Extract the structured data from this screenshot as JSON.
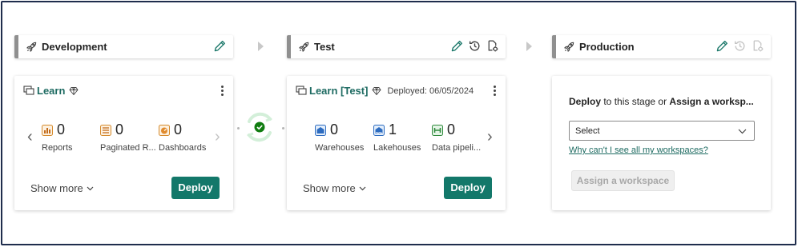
{
  "stages": [
    {
      "title": "Development",
      "workspace": "Learn",
      "deployed": "",
      "items": [
        {
          "count": "0",
          "label": "Reports",
          "icon": "report-icon"
        },
        {
          "count": "0",
          "label": "Paginated R...",
          "icon": "paginated-report-icon"
        },
        {
          "count": "0",
          "label": "Dashboards",
          "icon": "dashboard-icon"
        }
      ],
      "show_more": "Show more",
      "deploy_label": "Deploy"
    },
    {
      "title": "Test",
      "workspace": "Learn [Test]",
      "deployed": "Deployed: 06/05/2024",
      "items": [
        {
          "count": "0",
          "label": "Warehouses",
          "icon": "warehouse-icon"
        },
        {
          "count": "1",
          "label": "Lakehouses",
          "icon": "lakehouse-icon"
        },
        {
          "count": "0",
          "label": "Data pipeli...",
          "icon": "data-pipeline-icon"
        }
      ],
      "show_more": "Show more",
      "deploy_label": "Deploy"
    },
    {
      "title": "Production",
      "prompt_bold_1": "Deploy",
      "prompt_mid": " to this stage or ",
      "prompt_bold_2": "Assign a worksp...",
      "select_value": "Select",
      "why_link": "Why can't I see all my workspaces?",
      "assign_label": "Assign a workspace"
    }
  ],
  "colors": {
    "accent": "#13786a",
    "link": "#1e6b62",
    "sync_ok": "#107c10",
    "stage_bar": "#8f8f8f",
    "frame_border": "#1f2d4d"
  }
}
